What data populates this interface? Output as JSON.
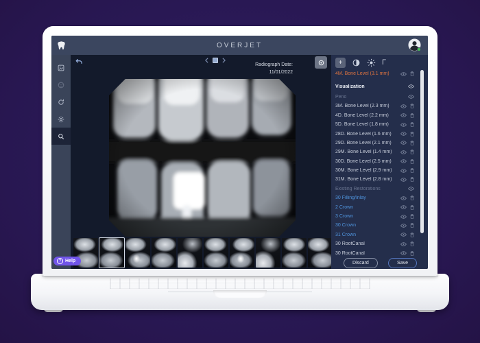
{
  "topbar": {
    "title": "OVERJET"
  },
  "icons": {
    "plus_glyph": "+",
    "gamma_glyph": "Γ",
    "help_q_glyph": "?",
    "sidebar": [
      "radiograph-icon",
      "patient-face-icon",
      "refresh-icon",
      "settings-gear-icon",
      "search-icon"
    ],
    "panel_toolbar": [
      "add-annotation-button",
      "contrast-icon",
      "brightness-icon",
      "gamma-icon"
    ]
  },
  "viewer": {
    "radiograph_date_label": "Radiograph Date:",
    "radiograph_date_value": "11/01/2022"
  },
  "filmstrip": {
    "count": 10,
    "selected_index": 1
  },
  "right_panel": {
    "rows": [
      {
        "label": "4M. Bone Level (3.1 mm)",
        "style": "orange",
        "trash": true
      },
      {
        "label": "Visualization",
        "style": "header",
        "trash": false
      },
      {
        "label": "Perio",
        "style": "dim",
        "trash": false
      },
      {
        "label": "3M. Bone Level (2.3 mm)",
        "style": "white",
        "trash": true
      },
      {
        "label": "4D. Bone Level (2.2 mm)",
        "style": "white",
        "trash": true
      },
      {
        "label": "5D. Bone Level (1.8 mm)",
        "style": "white",
        "trash": true
      },
      {
        "label": "28D. Bone Level (1.6 mm)",
        "style": "white",
        "trash": true
      },
      {
        "label": "29D. Bone Level (2.1 mm)",
        "style": "white",
        "trash": true
      },
      {
        "label": "29M. Bone Level (1.4 mm)",
        "style": "white",
        "trash": true
      },
      {
        "label": "30D. Bone Level (2.5 mm)",
        "style": "white",
        "trash": true
      },
      {
        "label": "30M. Bone Level (2.9 mm)",
        "style": "white",
        "trash": true
      },
      {
        "label": "31M. Bone Level (2.8 mm)",
        "style": "white",
        "trash": true
      },
      {
        "label": "Existing Restorations",
        "style": "dim",
        "trash": false
      },
      {
        "label": "30 Filling/Inlay",
        "style": "blue",
        "trash": true
      },
      {
        "label": "2 Crown",
        "style": "blue",
        "trash": true
      },
      {
        "label": "3 Crown",
        "style": "blue",
        "trash": true
      },
      {
        "label": "30 Crown",
        "style": "blue",
        "trash": true
      },
      {
        "label": "31 Crown",
        "style": "blue",
        "trash": true
      },
      {
        "label": "30 RootCanal",
        "style": "white",
        "trash": true
      },
      {
        "label": "30 RootCanal",
        "style": "white",
        "trash": true
      }
    ],
    "actions": {
      "discard": "Discard",
      "save": "Save"
    }
  },
  "help": {
    "label": "Help"
  },
  "theme": {
    "background": "#2b1b58",
    "topbar": "#3b465f",
    "sidebar": "#3a4459",
    "main_bg": "#131a2b",
    "panel_bg": "#242e4b",
    "accent_orange": "#e0743f",
    "accent_blue": "#4f93dc",
    "help_purple": "#7155ea",
    "online_green": "#46c354"
  }
}
